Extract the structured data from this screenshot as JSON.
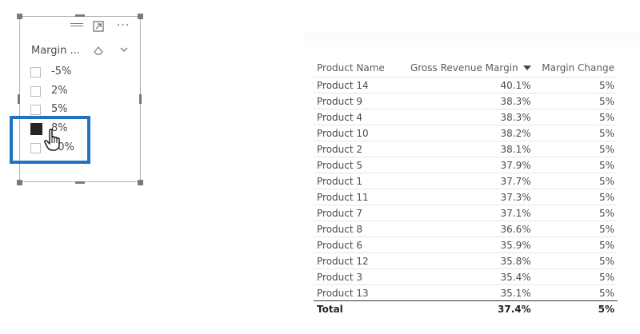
{
  "slicer": {
    "title": "Margin ...",
    "items": [
      {
        "label": "-5%",
        "checked": false
      },
      {
        "label": "2%",
        "checked": false
      },
      {
        "label": "5%",
        "checked": false
      },
      {
        "label": "8%",
        "checked": true
      },
      {
        "label": "10%",
        "checked": false
      }
    ],
    "icons": [
      "drag-grip-icon",
      "focus-mode-icon",
      "more-options-icon",
      "clear-selections-icon",
      "chevron-down-icon",
      "hand-cursor-icon"
    ],
    "highlight_color": "#1f73bf"
  },
  "table": {
    "columns": [
      "Product Name",
      "Gross Revenue Margin",
      "Margin Change"
    ],
    "sort_column": "Gross Revenue Margin",
    "rows": [
      [
        "Product 14",
        "40.1%",
        "5%"
      ],
      [
        "Product 9",
        "38.3%",
        "5%"
      ],
      [
        "Product 4",
        "38.3%",
        "5%"
      ],
      [
        "Product 10",
        "38.2%",
        "5%"
      ],
      [
        "Product 2",
        "38.1%",
        "5%"
      ],
      [
        "Product 5",
        "37.9%",
        "5%"
      ],
      [
        "Product 1",
        "37.7%",
        "5%"
      ],
      [
        "Product 11",
        "37.3%",
        "5%"
      ],
      [
        "Product 7",
        "37.1%",
        "5%"
      ],
      [
        "Product 8",
        "36.6%",
        "5%"
      ],
      [
        "Product 6",
        "35.9%",
        "5%"
      ],
      [
        "Product 12",
        "35.8%",
        "5%"
      ],
      [
        "Product 3",
        "35.4%",
        "5%"
      ],
      [
        "Product 13",
        "35.1%",
        "5%"
      ]
    ],
    "total": [
      "Total",
      "37.4%",
      "5%"
    ]
  }
}
